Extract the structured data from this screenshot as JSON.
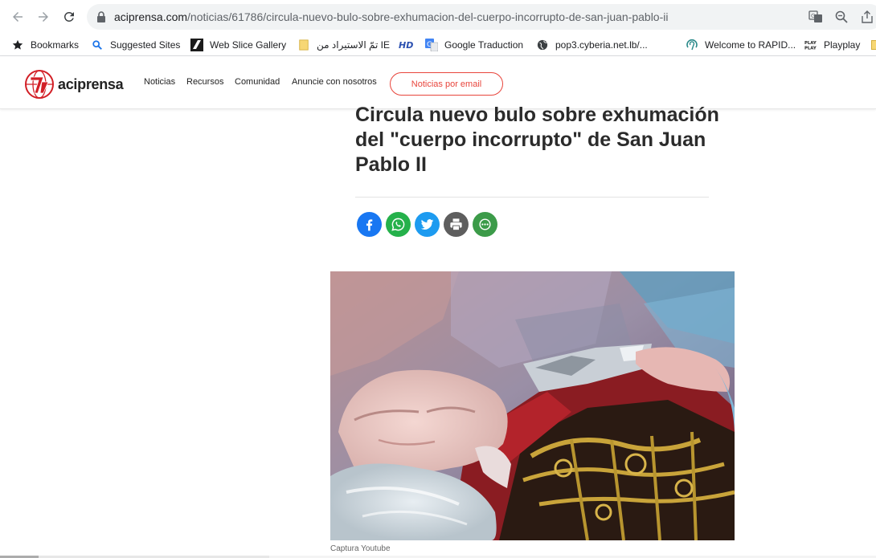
{
  "browser": {
    "url_domain": "aciprensa.com",
    "url_path": "/noticias/61786/circula-nuevo-bulo-sobre-exhumacion-del-cuerpo-incorrupto-de-san-juan-pablo-ii"
  },
  "bookmarks": [
    {
      "label": "Bookmarks",
      "icon": "star-icon"
    },
    {
      "label": "Suggested Sites",
      "icon": "search-icon"
    },
    {
      "label": "Web Slice Gallery",
      "icon": "web-slice-icon"
    },
    {
      "label": "تمّ الاستيراد من IE",
      "icon": "folder-icon"
    },
    {
      "label": "HD",
      "icon": "hd-icon"
    },
    {
      "label": "Google Traduction",
      "icon": "google-translate-icon"
    },
    {
      "label": "pop3.cyberia.net.lb/...",
      "icon": "globe-icon"
    },
    {
      "label": "Welcome to RAPID...",
      "icon": "rapid-icon"
    },
    {
      "label": "Playplay",
      "icon": "playplay-icon"
    }
  ],
  "site": {
    "logo_text": "aciprensa",
    "nav": [
      "Noticias",
      "Recursos",
      "Comunidad",
      "Anuncie con nosotros"
    ],
    "email_button": "Noticias por email",
    "accent_color": "#e8453c"
  },
  "article": {
    "headline": "Circula nuevo bulo sobre exhumación del \"cuerpo incorrupto\" de San Juan Pablo II",
    "caption": "Captura Youtube",
    "share": [
      {
        "name": "facebook",
        "color": "#1877f2"
      },
      {
        "name": "whatsapp",
        "color": "#25b14b"
      },
      {
        "name": "twitter",
        "color": "#1d9bf0"
      },
      {
        "name": "print",
        "color": "#5e5e5e"
      },
      {
        "name": "more",
        "color": "#3c9b49"
      }
    ]
  }
}
